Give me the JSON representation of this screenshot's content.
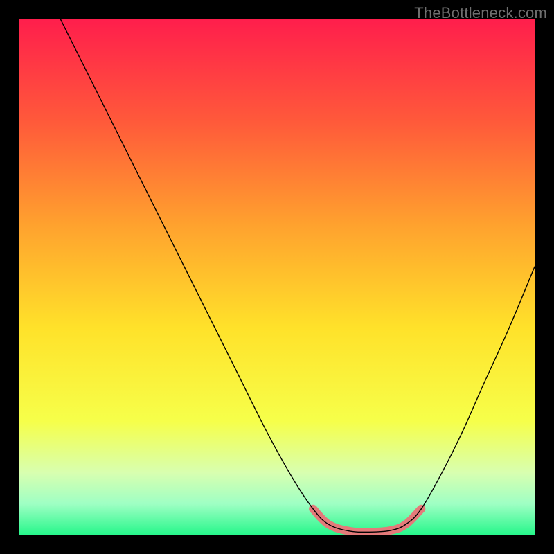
{
  "watermark": "TheBottleneck.com",
  "chart_data": {
    "type": "line",
    "title": "",
    "xlabel": "",
    "ylabel": "",
    "xlim": [
      0,
      100
    ],
    "ylim": [
      0,
      100
    ],
    "background_gradient": {
      "stops": [
        {
          "offset": 0.0,
          "color": "#ff1e4c"
        },
        {
          "offset": 0.2,
          "color": "#ff5a3a"
        },
        {
          "offset": 0.4,
          "color": "#ffa22e"
        },
        {
          "offset": 0.6,
          "color": "#ffe22a"
        },
        {
          "offset": 0.78,
          "color": "#f6ff4a"
        },
        {
          "offset": 0.88,
          "color": "#d8ffb0"
        },
        {
          "offset": 0.94,
          "color": "#9fffc4"
        },
        {
          "offset": 1.0,
          "color": "#27f78b"
        }
      ]
    },
    "curve": {
      "name": "bottleneck-curve",
      "color": "#000000",
      "width": 1.4,
      "points": [
        {
          "x": 8,
          "y": 100
        },
        {
          "x": 12,
          "y": 92
        },
        {
          "x": 18,
          "y": 80
        },
        {
          "x": 24,
          "y": 68
        },
        {
          "x": 30,
          "y": 56
        },
        {
          "x": 36,
          "y": 44
        },
        {
          "x": 42,
          "y": 32
        },
        {
          "x": 48,
          "y": 20
        },
        {
          "x": 53,
          "y": 11
        },
        {
          "x": 57,
          "y": 5
        },
        {
          "x": 60,
          "y": 2
        },
        {
          "x": 64,
          "y": 0.7
        },
        {
          "x": 68,
          "y": 0.5
        },
        {
          "x": 72,
          "y": 0.8
        },
        {
          "x": 75,
          "y": 2
        },
        {
          "x": 78,
          "y": 5
        },
        {
          "x": 82,
          "y": 12
        },
        {
          "x": 86,
          "y": 20
        },
        {
          "x": 90,
          "y": 29
        },
        {
          "x": 95,
          "y": 40
        },
        {
          "x": 100,
          "y": 52
        }
      ]
    },
    "highlight": {
      "name": "optimal-zone",
      "color": "#e47a7a",
      "width": 12,
      "cap": "round",
      "points": [
        {
          "x": 57,
          "y": 5
        },
        {
          "x": 60,
          "y": 2
        },
        {
          "x": 64,
          "y": 0.7
        },
        {
          "x": 68,
          "y": 0.5
        },
        {
          "x": 72,
          "y": 0.8
        },
        {
          "x": 75,
          "y": 2
        },
        {
          "x": 78,
          "y": 5
        }
      ]
    }
  }
}
